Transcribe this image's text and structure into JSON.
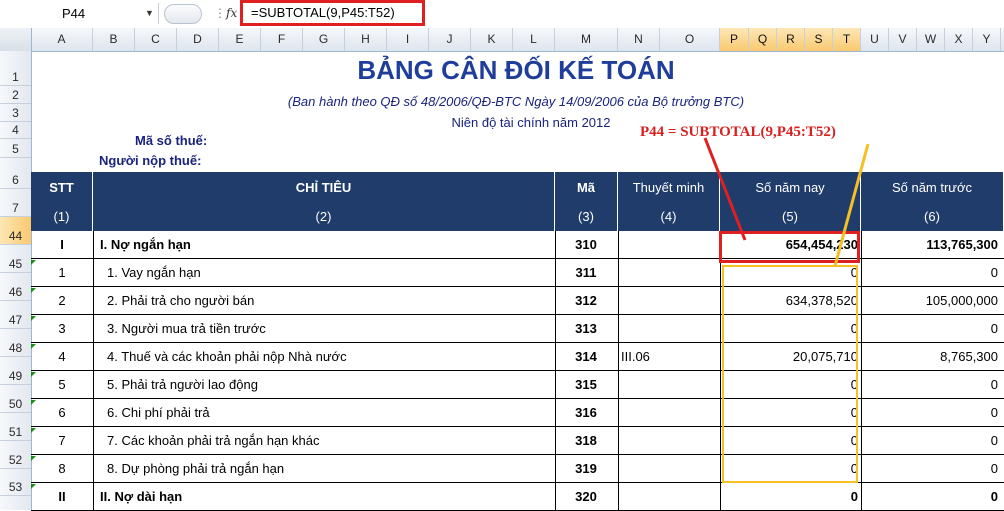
{
  "namebox": {
    "cell": "P44",
    "dropdown_icon": "dropdown-arrow-icon"
  },
  "formula_bar": {
    "fx_label": "fx",
    "formula": "=SUBTOTAL(9,P45:T52)"
  },
  "columns": [
    "A",
    "B",
    "C",
    "D",
    "E",
    "F",
    "G",
    "H",
    "I",
    "J",
    "K",
    "L",
    "M",
    "N",
    "O",
    "P",
    "Q",
    "R",
    "S",
    "T",
    "U",
    "V",
    "W",
    "X",
    "Y"
  ],
  "selected_columns": [
    "P",
    "Q",
    "R",
    "S",
    "T"
  ],
  "rows": [
    "1",
    "2",
    "3",
    "4",
    "5",
    "6",
    "7",
    "44",
    "45",
    "46",
    "47",
    "48",
    "49",
    "50",
    "51",
    "52",
    "53"
  ],
  "selected_row": "44",
  "sheet": {
    "title": "BẢNG CÂN ĐỐI KẾ TOÁN",
    "subtitle": "(Ban hành theo QĐ số 48/2006/QĐ-BTC Ngày 14/09/2006 của Bộ trưởng BTC)",
    "fiscal_year": "Niên độ tài chính năm 2012",
    "tax_code_label": "Mã số thuế:",
    "taxpayer_label": "Người nộp thuế:",
    "annotation": "P44 = SUBTOTAL(9,P45:T52)"
  },
  "table": {
    "headers": [
      "STT",
      "CHỈ TIÊU",
      "Mã",
      "Thuyết minh",
      "Số năm nay",
      "Số năm trước"
    ],
    "header_numbers": [
      "(1)",
      "(2)",
      "(3)",
      "(4)",
      "(5)",
      "(6)"
    ],
    "rows": [
      {
        "stt": "I",
        "name": "I. Nợ ngắn hạn",
        "code": "310",
        "note": "",
        "current": "654,454,230",
        "previous": "113,765,300",
        "bold": true
      },
      {
        "stt": "1",
        "name": "1. Vay ngắn hạn",
        "code": "311",
        "note": "",
        "current": "0",
        "previous": "0",
        "bold": false
      },
      {
        "stt": "2",
        "name": "2. Phải trả cho người bán",
        "code": "312",
        "note": "",
        "current": "634,378,520",
        "previous": "105,000,000",
        "bold": false
      },
      {
        "stt": "3",
        "name": "3. Người mua trả tiền trước",
        "code": "313",
        "note": "",
        "current": "0",
        "previous": "0",
        "bold": false
      },
      {
        "stt": "4",
        "name": "4. Thuế và các khoản phải nộp Nhà nước",
        "code": "314",
        "note": "III.06",
        "current": "20,075,710",
        "previous": "8,765,300",
        "bold": false
      },
      {
        "stt": "5",
        "name": "5. Phải trả người lao động",
        "code": "315",
        "note": "",
        "current": "0",
        "previous": "0",
        "bold": false
      },
      {
        "stt": "6",
        "name": "6. Chi phí phải trả",
        "code": "316",
        "note": "",
        "current": "0",
        "previous": "0",
        "bold": false
      },
      {
        "stt": "7",
        "name": "7. Các khoản phải trả ngắn hạn khác",
        "code": "318",
        "note": "",
        "current": "0",
        "previous": "0",
        "bold": false
      },
      {
        "stt": "8",
        "name": "8. Dự phòng phải trả ngắn hạn",
        "code": "319",
        "note": "",
        "current": "0",
        "previous": "0",
        "bold": false
      },
      {
        "stt": "II",
        "name": "II. Nợ dài hạn",
        "code": "320",
        "note": "",
        "current": "0",
        "previous": "0",
        "bold": true
      }
    ]
  },
  "colors": {
    "header_bg": "#1f3c6b",
    "title": "#1f3d9a",
    "highlight_red": "#e02020",
    "highlight_yellow": "#f5c026"
  }
}
